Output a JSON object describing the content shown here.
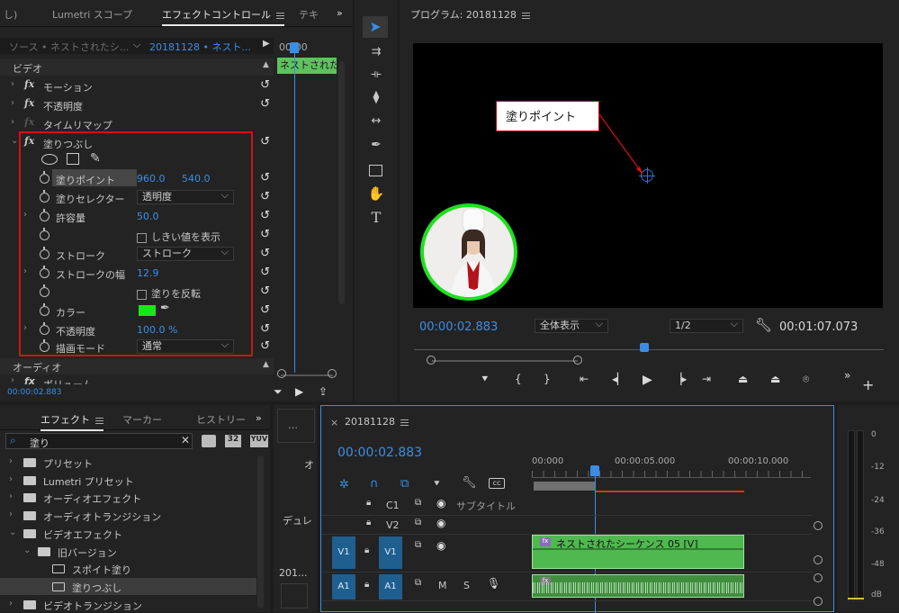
{
  "effect_controls": {
    "tabs": [
      "Lumetri スコープ",
      "エフェクトコントロール",
      "テキ"
    ],
    "left_partial": "し)",
    "source_label": "ソース • ネストされたシ...",
    "sequence_label": "20181128 • ネスト...",
    "timeline_time": "00:00",
    "clip_label": "ネストされた",
    "section_video": "ビデオ",
    "section_audio": "オーディオ",
    "audio_partial": "ボリューム",
    "current_time": "00:00:02.883",
    "effects": [
      {
        "label": "モーション"
      },
      {
        "label": "不透明度"
      },
      {
        "label": "タイムリマップ"
      },
      {
        "label": "塗りつぶし"
      }
    ],
    "fill_props": {
      "fill_point_label": "塗りポイント",
      "fill_point_x": "960.0",
      "fill_point_y": "540.0",
      "fill_selector_label": "塗りセレクター",
      "fill_selector_value": "透明度",
      "tolerance_label": "許容量",
      "tolerance_value": "50.0",
      "show_threshold_label": "しきい値を表示",
      "stroke_label": "ストローク",
      "stroke_value": "ストローク",
      "stroke_width_label": "ストロークの幅",
      "stroke_width_value": "12.9",
      "invert_fill_label": "塗りを反転",
      "color_label": "カラー",
      "color_value": "#19e619",
      "opacity_label": "不透明度",
      "opacity_value": "100.0 %",
      "blend_mode_label": "描画モード",
      "blend_mode_value": "通常"
    }
  },
  "program": {
    "title": "プログラム: 20181128",
    "callout": "塗りポイント",
    "current_time": "00:00:02.883",
    "zoom": "全体表示",
    "resolution": "1/2",
    "duration": "00:01:07.073"
  },
  "effects_panel": {
    "tabs": [
      "エフェクト",
      "マーカー",
      "ヒストリー"
    ],
    "search_value": "塗り",
    "badges": [
      "32",
      "YUV"
    ],
    "tree": [
      {
        "label": "プリセット",
        "depth": 0,
        "type": "folder-star",
        "expanded": false
      },
      {
        "label": "Lumetri プリセット",
        "depth": 0,
        "type": "folder-star",
        "expanded": false
      },
      {
        "label": "オーディオエフェクト",
        "depth": 0,
        "type": "folder",
        "expanded": false
      },
      {
        "label": "オーディオトランジション",
        "depth": 0,
        "type": "folder",
        "expanded": false
      },
      {
        "label": "ビデオエフェクト",
        "depth": 0,
        "type": "folder",
        "expanded": true
      },
      {
        "label": "旧バージョン",
        "depth": 1,
        "type": "folder",
        "expanded": true
      },
      {
        "label": "スポイト塗り",
        "depth": 2,
        "type": "effect",
        "expanded": false
      },
      {
        "label": "塗りつぶし",
        "depth": 2,
        "type": "effect",
        "expanded": false,
        "selected": true
      },
      {
        "label": "ビデオトランジション",
        "depth": 0,
        "type": "folder",
        "expanded": false
      }
    ]
  },
  "project_strip": {
    "items": [
      "オ",
      "デュレ",
      "201..."
    ]
  },
  "timeline": {
    "sequence": "20181128",
    "current_time": "00:00:02.883",
    "ruler": [
      "00:000",
      "00:00:05.000",
      "00:00:10.000"
    ],
    "tracks": {
      "c1": "C1",
      "subtitle": "サブタイトル",
      "v2": "V2",
      "v1_src": "V1",
      "v1": "V1",
      "a1_src": "A1",
      "a1": "A1",
      "mute": "M",
      "solo": "S"
    },
    "clip_label": "ネストされたシーケンス 05 [V]"
  },
  "meter": {
    "labels": [
      "0",
      "-12",
      "-24",
      "-36",
      "-48",
      "dB"
    ]
  }
}
